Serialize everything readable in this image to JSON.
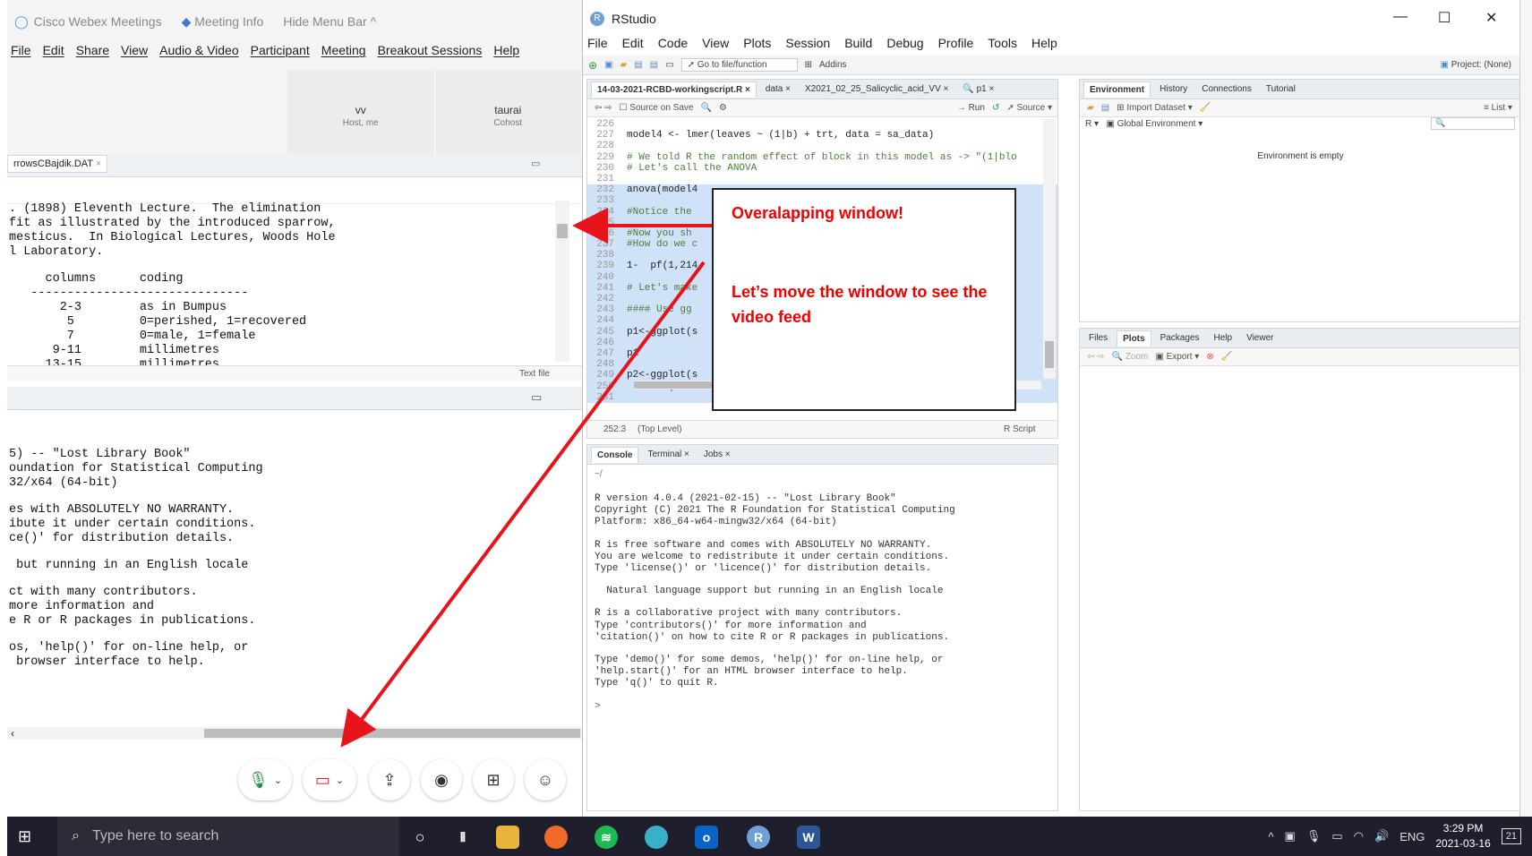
{
  "webex": {
    "app_title": "Cisco Webex Meetings",
    "meeting_info": "Meeting Info",
    "hide_menu": "Hide Menu Bar ^",
    "menu": [
      "File",
      "Edit",
      "Share",
      "View",
      "Audio & Video",
      "Participant",
      "Meeting",
      "Breakout Sessions",
      "Help"
    ],
    "participants": [
      {
        "name": "vv",
        "role": "Host, me"
      },
      {
        "name": "taurai",
        "role": "Cohost"
      }
    ],
    "shared_tab": "rrowsCBajdik.DAT",
    "shared_text_type": "Text file",
    "shared_lines": [
      ". (1898) Eleventh Lecture.  The elimination",
      "fit as illustrated by the introduced sparrow,",
      "mesticus.  In Biological Lectures, Woods Hole",
      "l Laboratory.",
      "",
      "     columns      coding",
      "   ------------------------------",
      "       2-3        as in Bumpus",
      "        5         0=perished, 1=recovered",
      "        7         0=male, 1=female",
      "      9-11        millimetres",
      "     13-15        millimetres"
    ],
    "console_lines": [
      "5) -- \"Lost Library Book\"",
      "oundation for Statistical Computing",
      "32/x64 (64-bit)",
      "",
      "es with ABSOLUTELY NO WARRANTY.",
      "ibute it under certain conditions.",
      "ce()' for distribution details.",
      "",
      " but running in an English locale",
      "",
      "ct with many contributors.",
      "more information and",
      "e R or R packages in publications.",
      "",
      "os, 'help()' for on-line help, or",
      " browser interface to help."
    ]
  },
  "rstudio": {
    "title": "RStudio",
    "menu": [
      "File",
      "Edit",
      "Code",
      "View",
      "Plots",
      "Session",
      "Build",
      "Debug",
      "Profile",
      "Tools",
      "Help"
    ],
    "toolbar": {
      "goto": "Go to file/function",
      "addins": "Addins",
      "project": "Project: (None)"
    },
    "editor_tabs": [
      "14-03-2021-RCBD-workingscript.R",
      "data",
      "X2021_02_25_Salicyclic_acid_VV",
      "p1"
    ],
    "editor_sub": {
      "source_on_save": "Source on Save",
      "run": "Run",
      "source": "Source"
    },
    "code": [
      {
        "n": "226",
        "t": ""
      },
      {
        "n": "227",
        "t": "model4 <- lmer(leaves ~ (1|b) + trt, data = sa_data)"
      },
      {
        "n": "228",
        "t": ""
      },
      {
        "n": "229",
        "t": "# We told R the random effect of block in this model as -> \"(1|blo"
      },
      {
        "n": "230",
        "t": "# Let's call the ANOVA"
      },
      {
        "n": "231",
        "t": ""
      },
      {
        "n": "232",
        "t": "anova(model4"
      },
      {
        "n": "233",
        "t": ""
      },
      {
        "n": "234",
        "t": "#Notice the                                                and m"
      },
      {
        "n": "235",
        "t": ""
      },
      {
        "n": "236",
        "t": "#Now you sh                                                is mis"
      },
      {
        "n": "237",
        "t": "#How do we c"
      },
      {
        "n": "238",
        "t": ""
      },
      {
        "n": "239",
        "t": "1-  pf(1,214"
      },
      {
        "n": "240",
        "t": ""
      },
      {
        "n": "241",
        "t": "# Let's make"
      },
      {
        "n": "242",
        "t": ""
      },
      {
        "n": "243",
        "t": "#### Use gg                                                the po"
      },
      {
        "n": "244",
        "t": ""
      },
      {
        "n": "245",
        "t": "p1<-ggplot(s                                               oxplot"
      },
      {
        "n": "246",
        "t": ""
      },
      {
        "n": "247",
        "t": "p1"
      },
      {
        "n": "248",
        "t": ""
      },
      {
        "n": "249",
        "t": "p2<-ggplot(s                                               + face"
      },
      {
        "n": "250",
        "t": "  theme( axi                                               nt bla"
      },
      {
        "n": "251",
        "t": ""
      }
    ],
    "status": {
      "pos": "252:3",
      "level": "(Top Level)",
      "type": "R Script"
    },
    "console_tabs": [
      "Console",
      "Terminal",
      "Jobs"
    ],
    "console_path": "~/",
    "console_lines": [
      "R version 4.0.4 (2021-02-15) -- \"Lost Library Book\"",
      "Copyright (C) 2021 The R Foundation for Statistical Computing",
      "Platform: x86_64-w64-mingw32/x64 (64-bit)",
      "",
      "R is free software and comes with ABSOLUTELY NO WARRANTY.",
      "You are welcome to redistribute it under certain conditions.",
      "Type 'license()' or 'licence()' for distribution details.",
      "",
      "  Natural language support but running in an English locale",
      "",
      "R is a collaborative project with many contributors.",
      "Type 'contributors()' for more information and",
      "'citation()' on how to cite R or R packages in publications.",
      "",
      "Type 'demo()' for some demos, 'help()' for on-line help, or",
      "'help.start()' for an HTML browser interface to help.",
      "Type 'q()' to quit R.",
      "",
      ">"
    ],
    "env_tabs": [
      "Environment",
      "History",
      "Connections",
      "Tutorial"
    ],
    "env_sub": {
      "import": "Import Dataset",
      "list": "List",
      "r": "R",
      "global": "Global Environment"
    },
    "env_empty": "Environment is empty",
    "files_tabs": [
      "Files",
      "Plots",
      "Packages",
      "Help",
      "Viewer"
    ],
    "files_sub": {
      "zoom": "Zoom",
      "export": "Export"
    }
  },
  "annotation": {
    "line1": "Overalapping window!",
    "line2": "Let’s move the window to see the video feed"
  },
  "taskbar": {
    "search_placeholder": "Type here to search",
    "lang": "ENG",
    "time": "3:29 PM",
    "date": "2021-03-16",
    "notif": "21"
  },
  "colors": {
    "arrow": "#e8141b",
    "taskbar": "#1e1e2c",
    "selection": "#cfe2f8"
  }
}
